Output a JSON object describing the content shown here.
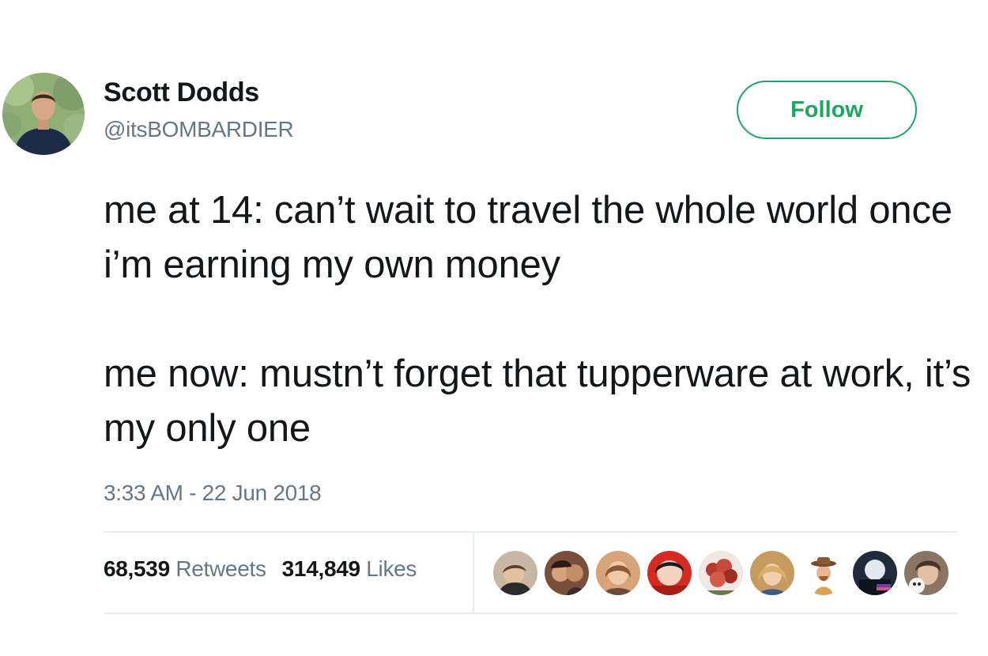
{
  "user": {
    "name": "Scott Dodds",
    "handle": "@itsBOMBARDIER"
  },
  "follow_label": "Follow",
  "tweet": {
    "paragraph1": "me at 14: can’t wait to travel the whole world once i’m earning my own money",
    "paragraph2": "me now: mustn’t forget that tupperware at work, it’s my only one",
    "timestamp": "3:33 AM - 22 Jun 2018"
  },
  "stats": {
    "retweets_count": "68,539",
    "retweets_label": "Retweets",
    "likes_count": "314,849",
    "likes_label": "Likes"
  },
  "likers": [
    {
      "color": "#c9b7a6"
    },
    {
      "color": "#7a4e3a"
    },
    {
      "color": "#d9a37a"
    },
    {
      "color": "#d42a22"
    },
    {
      "color": "#b53a2f"
    },
    {
      "color": "#c69b5f"
    },
    {
      "color": "#e8e1d6"
    },
    {
      "color": "#1f2a3a"
    },
    {
      "color": "#8a7565"
    }
  ],
  "colors": {
    "follow_accent": "#1da861",
    "secondary_text": "#657786",
    "divider": "#e6ecf0"
  }
}
